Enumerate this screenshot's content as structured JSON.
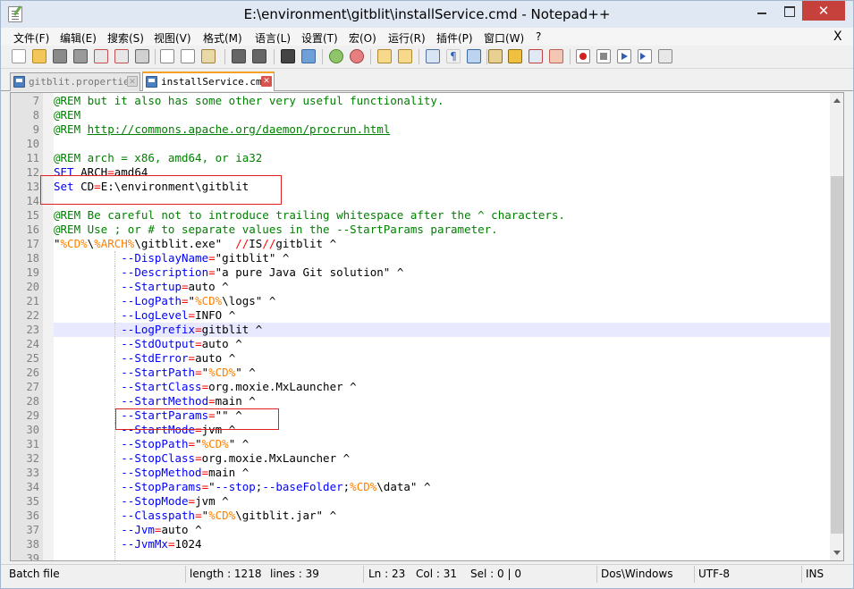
{
  "window": {
    "title": "E:\\environment\\gitblit\\installService.cmd - Notepad++",
    "close_glyph": "✕"
  },
  "menu": {
    "items": [
      "文件(F)",
      "编辑(E)",
      "搜索(S)",
      "视图(V)",
      "格式(M)",
      "语言(L)",
      "设置(T)",
      "宏(O)",
      "运行(R)",
      "插件(P)",
      "窗口(W)",
      "?"
    ],
    "close": "X"
  },
  "tabs": [
    {
      "label": "gitblit.properties",
      "close": "✕"
    },
    {
      "label": "installService.cmd",
      "close": "✕"
    }
  ],
  "editor": {
    "current_line": 23,
    "lines": [
      {
        "n": "7",
        "t": "@REM but it also has some other very useful functionality."
      },
      {
        "n": "8",
        "t": "@REM"
      },
      {
        "n": "9",
        "t": "@REM http://commons.apache.org/daemon/procrun.html"
      },
      {
        "n": "10",
        "t": ""
      },
      {
        "n": "11",
        "t": "@REM arch = x86, amd64, or ia32"
      },
      {
        "n": "12",
        "t": "SET ARCH=amd64"
      },
      {
        "n": "13",
        "t": "Set CD=E:\\environment\\gitblit"
      },
      {
        "n": "14",
        "t": ""
      },
      {
        "n": "15",
        "t": "@REM Be careful not to introduce trailing whitespace after the ^ characters."
      },
      {
        "n": "16",
        "t": "@REM Use ; or # to separate values in the --StartParams parameter."
      },
      {
        "n": "17",
        "t": "\"%CD%\\%ARCH%\\gitblit.exe\"  //IS//gitblit ^"
      },
      {
        "n": "18",
        "t": "          --DisplayName=\"gitblit\" ^"
      },
      {
        "n": "19",
        "t": "          --Description=\"a pure Java Git solution\" ^"
      },
      {
        "n": "20",
        "t": "          --Startup=auto ^"
      },
      {
        "n": "21",
        "t": "          --LogPath=\"%CD%\\logs\" ^"
      },
      {
        "n": "22",
        "t": "          --LogLevel=INFO ^"
      },
      {
        "n": "23",
        "t": "          --LogPrefix=gitblit ^"
      },
      {
        "n": "24",
        "t": "          --StdOutput=auto ^"
      },
      {
        "n": "25",
        "t": "          --StdError=auto ^"
      },
      {
        "n": "26",
        "t": "          --StartPath=\"%CD%\" ^"
      },
      {
        "n": "27",
        "t": "          --StartClass=org.moxie.MxLauncher ^"
      },
      {
        "n": "28",
        "t": "          --StartMethod=main ^"
      },
      {
        "n": "29",
        "t": "          --StartParams=\"\" ^"
      },
      {
        "n": "30",
        "t": "          --StartMode=jvm ^"
      },
      {
        "n": "31",
        "t": "          --StopPath=\"%CD%\" ^"
      },
      {
        "n": "32",
        "t": "          --StopClass=org.moxie.MxLauncher ^"
      },
      {
        "n": "33",
        "t": "          --StopMethod=main ^"
      },
      {
        "n": "34",
        "t": "          --StopParams=\"--stop;--baseFolder;%CD%\\data\" ^"
      },
      {
        "n": "35",
        "t": "          --StopMode=jvm ^"
      },
      {
        "n": "36",
        "t": "          --Classpath=\"%CD%\\gitblit.jar\" ^"
      },
      {
        "n": "37",
        "t": "          --Jvm=auto ^"
      },
      {
        "n": "38",
        "t": "          --JvmMx=1024"
      },
      {
        "n": "39",
        "t": ""
      }
    ]
  },
  "status": {
    "language": "Batch file",
    "length": "length : 1218",
    "lines": "lines : 39",
    "ln": "Ln : 23",
    "col": "Col : 31",
    "sel": "Sel : 0 | 0",
    "eol": "Dos\\Windows",
    "encoding": "UTF-8",
    "mode": "INS"
  },
  "colors": {
    "comment": "#008000",
    "keyword": "#0000ff",
    "variable": "#ff8000",
    "operator": "#ff0000",
    "annotation": "#e02020",
    "current_line": "#e8e8ff",
    "active_tab_accent": "#f5a123"
  },
  "toolbar_icons": [
    "new-file-icon",
    "open-file-icon",
    "save-icon",
    "save-all-icon",
    "close-icon",
    "close-all-icon",
    "print-icon",
    "cut-icon",
    "copy-icon",
    "paste-icon",
    "undo-icon",
    "redo-icon",
    "find-icon",
    "replace-icon",
    "zoom-in-icon",
    "zoom-out-icon",
    "sync-vertical-icon",
    "sync-horizontal-icon",
    "word-wrap-icon",
    "show-all-chars-icon",
    "indent-guide-icon",
    "language-define-icon",
    "doc-map-icon",
    "function-list-icon",
    "folder-workspace-icon",
    "record-macro-icon",
    "stop-macro-icon",
    "play-macro-icon",
    "run-macro-multiple-icon",
    "save-macro-icon"
  ]
}
